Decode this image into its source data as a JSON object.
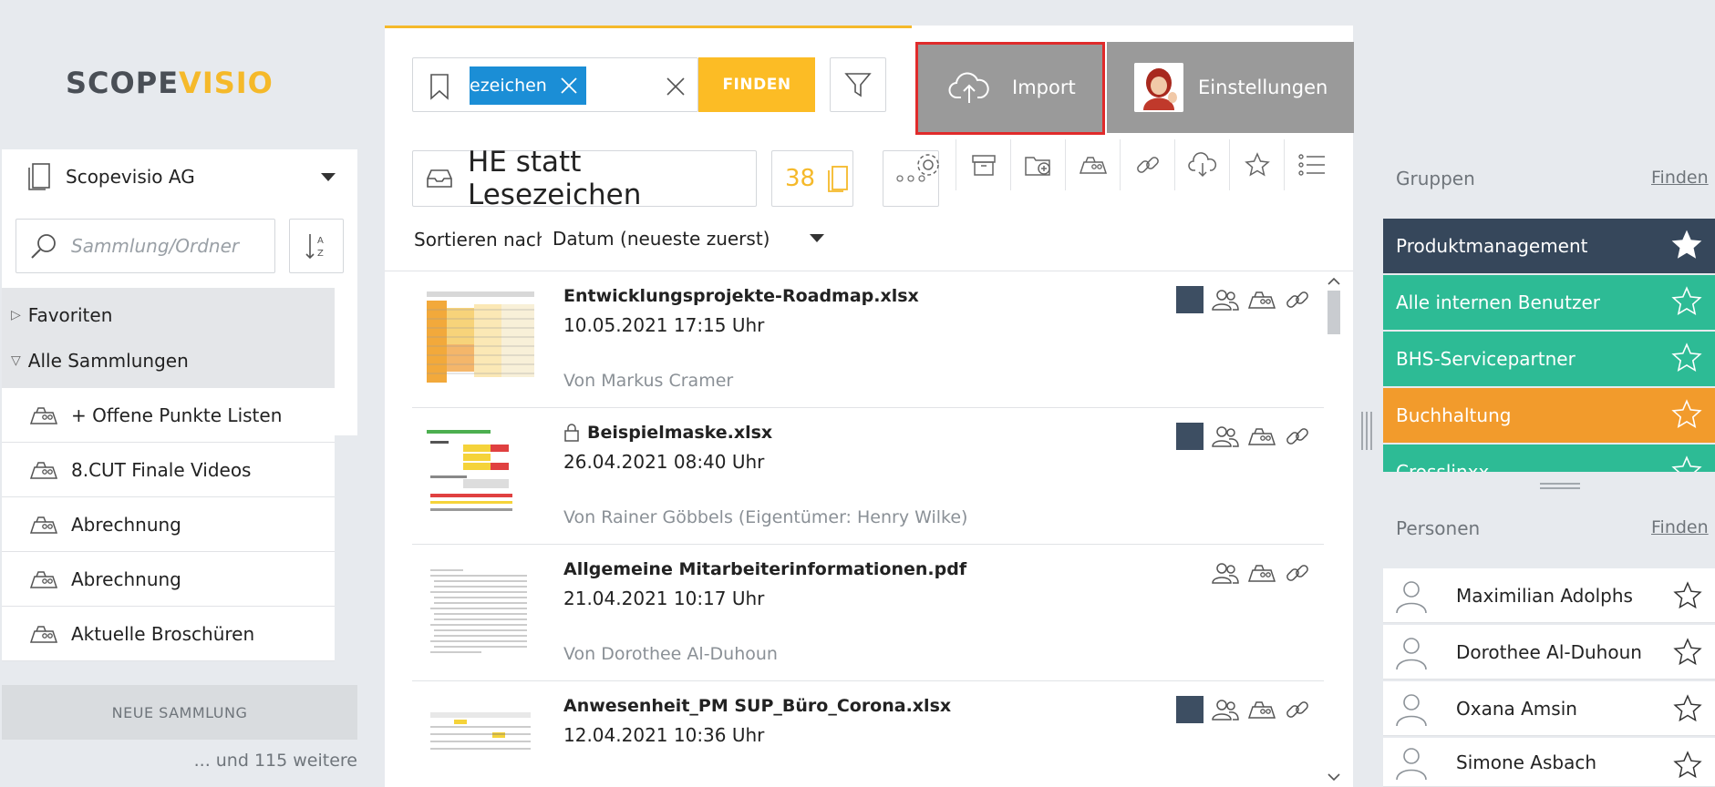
{
  "brand": {
    "part1": "SCOPE",
    "part2": "VISIO"
  },
  "colors": {
    "accent": "#fcbc25",
    "dark_blue": "#3d4e62",
    "teal": "#2dbb95",
    "orange": "#f29b2c",
    "highlight_red": "#e02b2b"
  },
  "company_selector": {
    "name": "Scopevisio AG",
    "icon": "document-stack-icon"
  },
  "collection_search": {
    "placeholder": "Sammlung/Ordner"
  },
  "tree": {
    "favorites": "Favoriten",
    "all_collections": "Alle Sammlungen",
    "items": [
      {
        "label": "+ Offene Punkte Listen"
      },
      {
        "label": "8.CUT Finale Videos"
      },
      {
        "label": "Abrechnung"
      },
      {
        "label": "Abrechnung"
      },
      {
        "label": "Aktuelle Broschüren"
      }
    ]
  },
  "new_collection_label": "NEUE SAMMLUNG",
  "more_label": "... und 115 weitere",
  "search": {
    "tag": "ezeichen",
    "button": "FINDEN"
  },
  "collection": {
    "title": "HE statt Lesezeichen",
    "count": "38"
  },
  "sort": {
    "label": "Sortieren nach:",
    "value": "Datum (neueste zuerst)"
  },
  "documents": [
    {
      "name": "Entwicklungsprojekte-Roadmap.xlsx",
      "date": "10.05.2021 17:15 Uhr",
      "by": "Von Markus Cramer",
      "locked": false,
      "square": true
    },
    {
      "name": "Beispielmaske.xlsx",
      "date": "26.04.2021 08:40 Uhr",
      "by": "Von Rainer Göbbels (Eigentümer: Henry Wilke)",
      "locked": true,
      "square": true
    },
    {
      "name": "Allgemeine Mitarbeiterinformationen.pdf",
      "date": "21.04.2021 10:17 Uhr",
      "by": "Von Dorothee Al-Duhoun",
      "locked": false,
      "square": false
    },
    {
      "name": "Anwesenheit_PM SUP_Büro_Corona.xlsx",
      "date": "12.04.2021 10:36 Uhr",
      "by": "",
      "locked": false,
      "square": true
    }
  ],
  "top_buttons": {
    "import": "Import",
    "settings": "Einstellungen"
  },
  "groups": {
    "title": "Gruppen",
    "find": "Finden",
    "items": [
      {
        "label": "Produktmanagement",
        "color": "#36475b",
        "favorite": true
      },
      {
        "label": "Alle internen Benutzer",
        "color": "#2dbb95",
        "favorite": false
      },
      {
        "label": "BHS-Servicepartner",
        "color": "#2dbb95",
        "favorite": false
      },
      {
        "label": "Buchhaltung",
        "color": "#f29b2c",
        "favorite": false
      },
      {
        "label": "Crosslinxx",
        "color": "#2dbb95",
        "favorite": false
      }
    ]
  },
  "persons": {
    "title": "Personen",
    "find": "Finden",
    "items": [
      {
        "name": "Maximilian Adolphs"
      },
      {
        "name": "Dorothee Al-Duhoun"
      },
      {
        "name": "Oxana Amsin"
      },
      {
        "name": "Simone Asbach"
      }
    ]
  }
}
